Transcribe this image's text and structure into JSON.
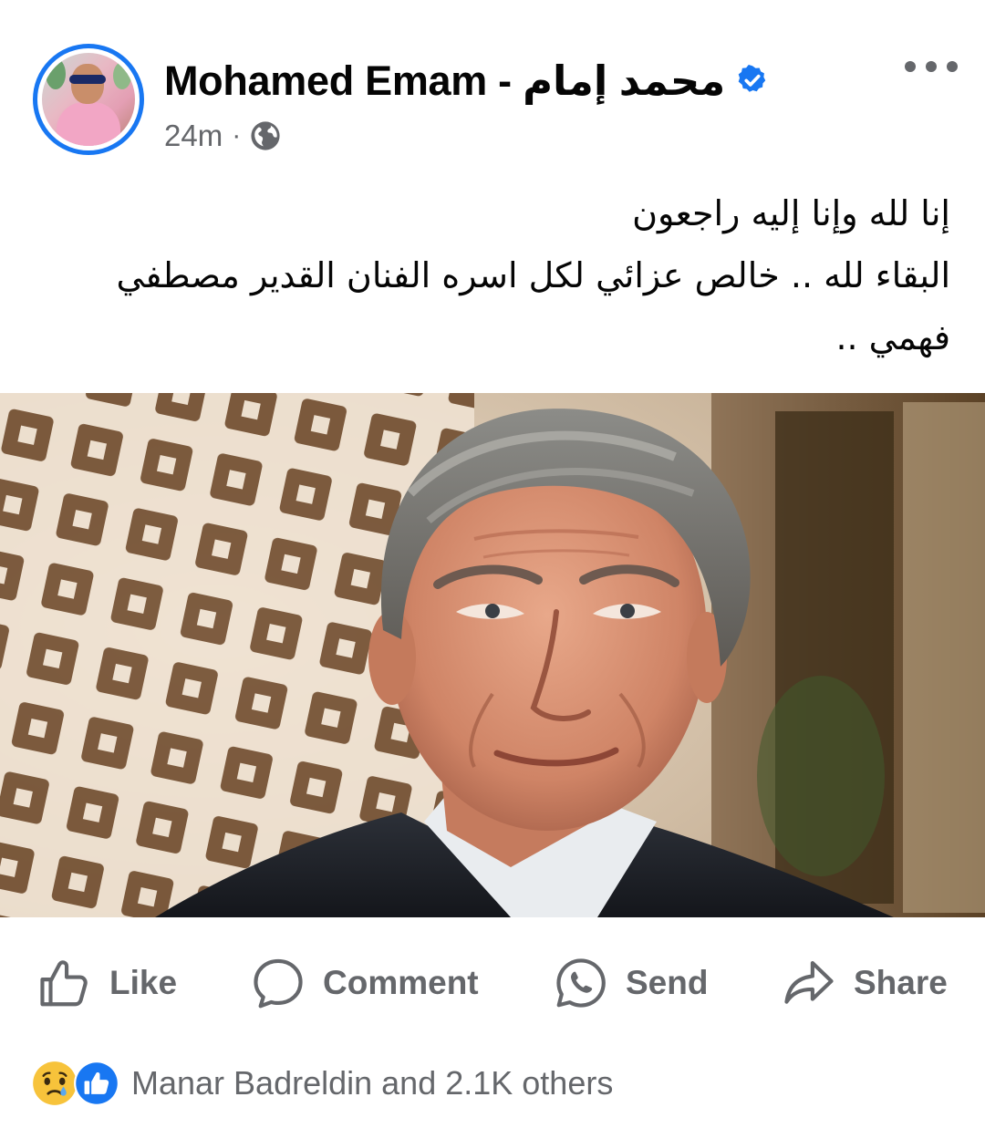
{
  "post": {
    "author_name": "Mohamed Emam - محمد إمام",
    "timestamp": "24m",
    "separator": "·",
    "audience_icon": "globe-icon",
    "verified_icon": "verified-badge-icon",
    "text_lines": [
      "إنا لله وإنا إليه راجعون",
      "البقاء لله .. خالص عزائي لكل اسره الفنان القدير مصطفي فهمي .."
    ]
  },
  "actions": {
    "like": "Like",
    "comment": "Comment",
    "send": "Send",
    "share": "Share"
  },
  "reactions": {
    "summary": "Manar Badreldin and 2.1K others",
    "icons": [
      "sad-reaction-icon",
      "like-reaction-icon"
    ]
  },
  "colors": {
    "brand_blue": "#1877f2",
    "secondary_text": "#65676b",
    "primary_text": "#050505",
    "sad_yellow": "#f7c33b"
  }
}
